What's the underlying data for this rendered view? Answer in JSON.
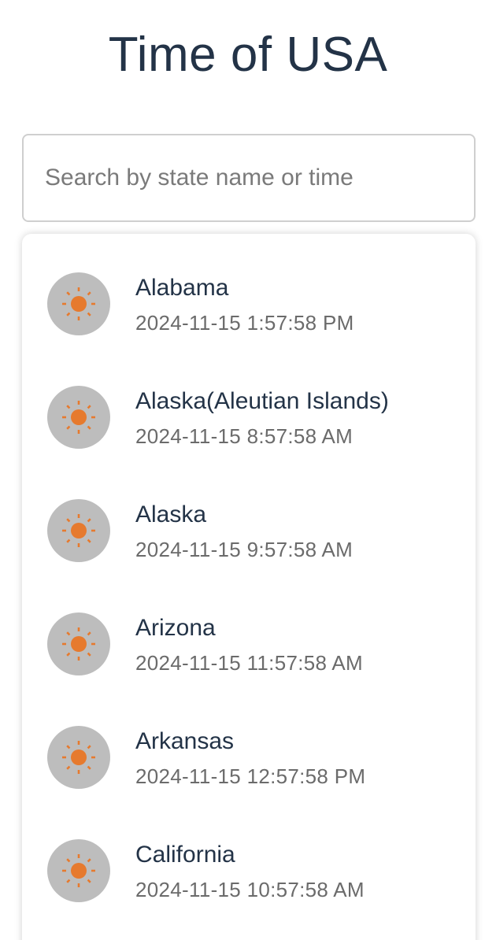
{
  "header": {
    "title": "Time of USA"
  },
  "search": {
    "placeholder": "Search by state name or time",
    "value": ""
  },
  "states": [
    {
      "name": "Alabama",
      "time": "2024-11-15 1:57:58 PM",
      "icon": "sun-icon"
    },
    {
      "name": "Alaska(Aleutian Islands)",
      "time": "2024-11-15 8:57:58 AM",
      "icon": "sun-icon"
    },
    {
      "name": "Alaska",
      "time": "2024-11-15 9:57:58 AM",
      "icon": "sun-icon"
    },
    {
      "name": "Arizona",
      "time": "2024-11-15 11:57:58 AM",
      "icon": "sun-icon"
    },
    {
      "name": "Arkansas",
      "time": "2024-11-15 12:57:58 PM",
      "icon": "sun-icon"
    },
    {
      "name": "California",
      "time": "2024-11-15 10:57:58 AM",
      "icon": "sun-icon"
    }
  ],
  "colors": {
    "title": "#233347",
    "sun": "#e67a2e",
    "avatar_bg": "#bdbdbd",
    "secondary_text": "#6b6b6b"
  }
}
